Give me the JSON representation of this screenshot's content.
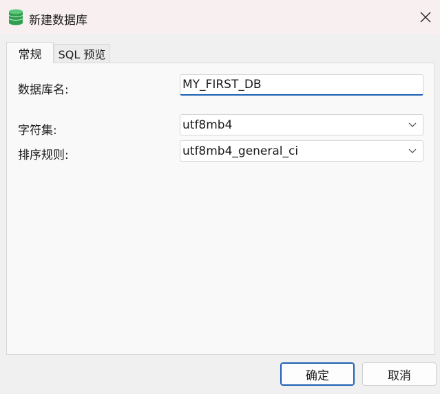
{
  "window": {
    "title": "新建数据库"
  },
  "tabs": [
    {
      "label": "常规",
      "active": true
    },
    {
      "label": "SQL 预览",
      "active": false
    }
  ],
  "form": {
    "name_label": "数据库名:",
    "name_value": "MY_FIRST_DB",
    "charset_label": "字符集:",
    "charset_value": "utf8mb4",
    "collation_label": "排序规则:",
    "collation_value": "utf8mb4_general_ci"
  },
  "buttons": {
    "ok": "确定",
    "cancel": "取消"
  },
  "icons": {
    "app": "database-icon",
    "close": "close-icon",
    "dropdown": "chevron-down-icon"
  },
  "colors": {
    "accent": "#1a5fb4",
    "db_icon": "#2e9e4f"
  }
}
